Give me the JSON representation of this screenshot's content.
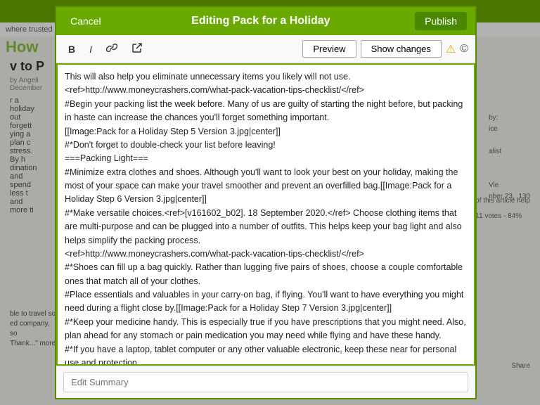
{
  "header": {
    "cancel_label": "Cancel",
    "title": "Editing Pack for a Holiday",
    "publish_label": "Publish"
  },
  "toolbar": {
    "bold_label": "B",
    "italic_label": "I",
    "link_label": "🔗",
    "external_link_label": "↗",
    "preview_label": "Preview",
    "show_changes_label": "Show changes",
    "warning_icon": "⚠",
    "cc_icon": "©"
  },
  "editor": {
    "content": "This will also help you eliminate unnecessary items you likely will not use.\n<ref>http://www.moneycrashers.com/what-pack-vacation-tips-checklist/</ref>\n#Begin your packing list the week before. Many of us are guilty of starting the night before, but packing in haste can increase the chances you'll forget something important.\n[[Image:Pack for a Holiday Step 5 Version 3.jpg|center]]\n#*Don't forget to double-check your list before leaving!\n===Packing Light===\n#Minimize extra clothes and shoes. Although you'll want to look your best on your holiday, making the most of your space can make your travel smoother and prevent an overfilled bag.[[Image:Pack for a Holiday Step 6 Version 3.jpg|center]]\n#*Make versatile choices.<ref>[v161602_b02]. 18 September 2020.</ref> Choose clothing items that are multi-purpose and can be plugged into a number of outfits. This helps keep your bag light and also helps simplify the packing process.\n<ref>http://www.moneycrashers.com/what-pack-vacation-tips-checklist/</ref>\n#*Shoes can fill up a bag quickly. Rather than lugging five pairs of shoes, choose a couple comfortable ones that match all of your clothes.\n#Place essentials and valuables in your carry-on bag, if flying. You'll want to have everything you might need during a flight close by.[[Image:Pack for a Holiday Step 7 Version 3.jpg|center]]\n#*Keep your medicine handy. This is especially true if you have prescriptions that you might need. Also, plan ahead for any stomach or pain medication you may need while flying and have these handy.\n#*If you have a laptop, tablet computer or any other valuable electronic, keep these near for personal use and protection.\n#*"
  },
  "edit_summary": {
    "placeholder": "Edit Summary",
    "value": ""
  }
}
